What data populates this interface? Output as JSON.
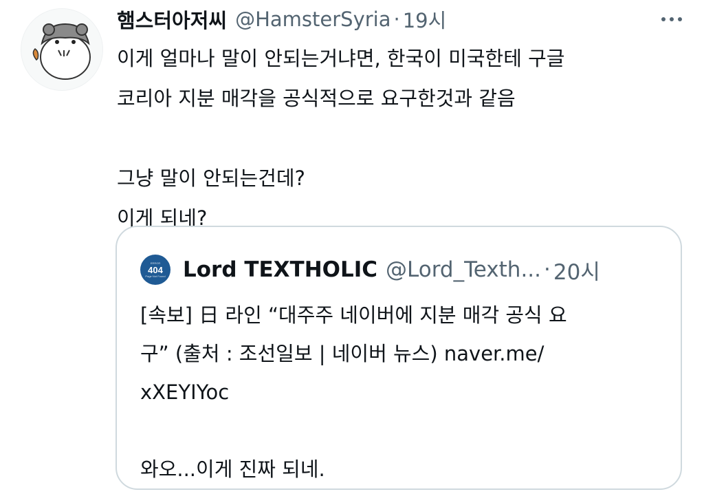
{
  "tweet": {
    "display_name": "햄스터아저씨",
    "handle": "@HamsterSyria",
    "separator": "·",
    "time": "19시",
    "lines": [
      "이게 얼마나 말이 안되는거냐면, 한국이 미국한테 구글",
      "코리아 지분 매각을 공식적으로 요구한것과 같음",
      "그냥 말이 안되는건데?",
      "이게 되네?"
    ]
  },
  "quote": {
    "avatar_number": "404",
    "display_name": "Lord TEXTHOLIC",
    "handle": "@Lord_Texth...",
    "separator": "·",
    "time": "20시",
    "lines": [
      "[속보] 日 라인 “대주주 네이버에 지분 매각 공식 요",
      "구” (출처 : 조선일보 | 네이버 뉴스) naver.me/",
      "xXEYIYoc",
      "와오...이게 진짜 되네."
    ]
  },
  "icons": {
    "avatar": "hamster-avatar-icon",
    "more": "more-horizontal-icon",
    "quote_avatar": "404-avatar-icon"
  },
  "colors": {
    "text_primary": "#0f1419",
    "text_secondary": "#536471",
    "border": "#cfd9de",
    "quote_avatar_bg": "#1f5a94"
  }
}
